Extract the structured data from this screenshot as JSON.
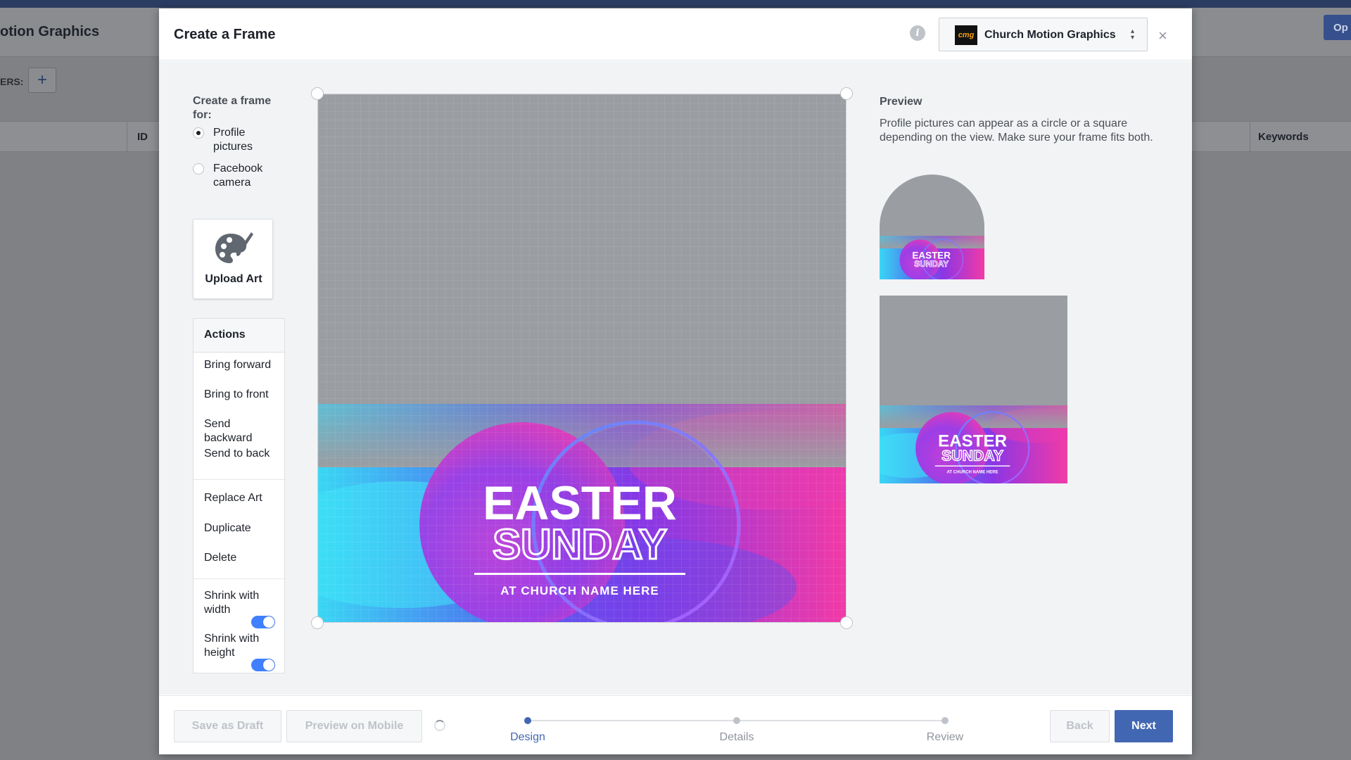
{
  "background": {
    "title": "otion Graphics",
    "filters_label": "ERS:",
    "add_label": "+",
    "col_id": "ID",
    "col_keywords": "Keywords",
    "options_label": "Op"
  },
  "modal": {
    "title": "Create a Frame",
    "page_selector": {
      "logo_text": "cmg",
      "name": "Church Motion Graphics",
      "caret": "▴\n▾"
    },
    "close": "×"
  },
  "left": {
    "frame_for": "Create a frame for:",
    "options": [
      {
        "label": "Profile pictures",
        "selected": true
      },
      {
        "label": "Facebook camera",
        "selected": false
      }
    ],
    "upload_label": "Upload Art",
    "actions_title": "Actions",
    "arrange": [
      "Bring forward",
      "Bring to front",
      "Send backward",
      "Send to back"
    ],
    "replace": "Replace Art",
    "duplicate": "Duplicate",
    "delete": "Delete",
    "shrink_width": "Shrink with width",
    "shrink_height": "Shrink with height",
    "shrink_width_on": true,
    "shrink_height_on": true
  },
  "art": {
    "line1": "EASTER",
    "line2": "SUNDAY",
    "line3": "AT CHURCH NAME HERE"
  },
  "preview": {
    "title": "Preview",
    "description": "Profile pictures can appear as a circle or a square depending on the view. Make sure your frame fits both."
  },
  "footer": {
    "save_draft": "Save as Draft",
    "preview_mobile": "Preview on Mobile",
    "back": "Back",
    "next": "Next",
    "steps": [
      {
        "label": "Design",
        "active": true
      },
      {
        "label": "Details",
        "active": false
      },
      {
        "label": "Review",
        "active": false
      }
    ]
  },
  "colors": {
    "accent": "#4267b2",
    "toggle_on": "#4080ff",
    "canvas_bg": "#9a9da2"
  }
}
